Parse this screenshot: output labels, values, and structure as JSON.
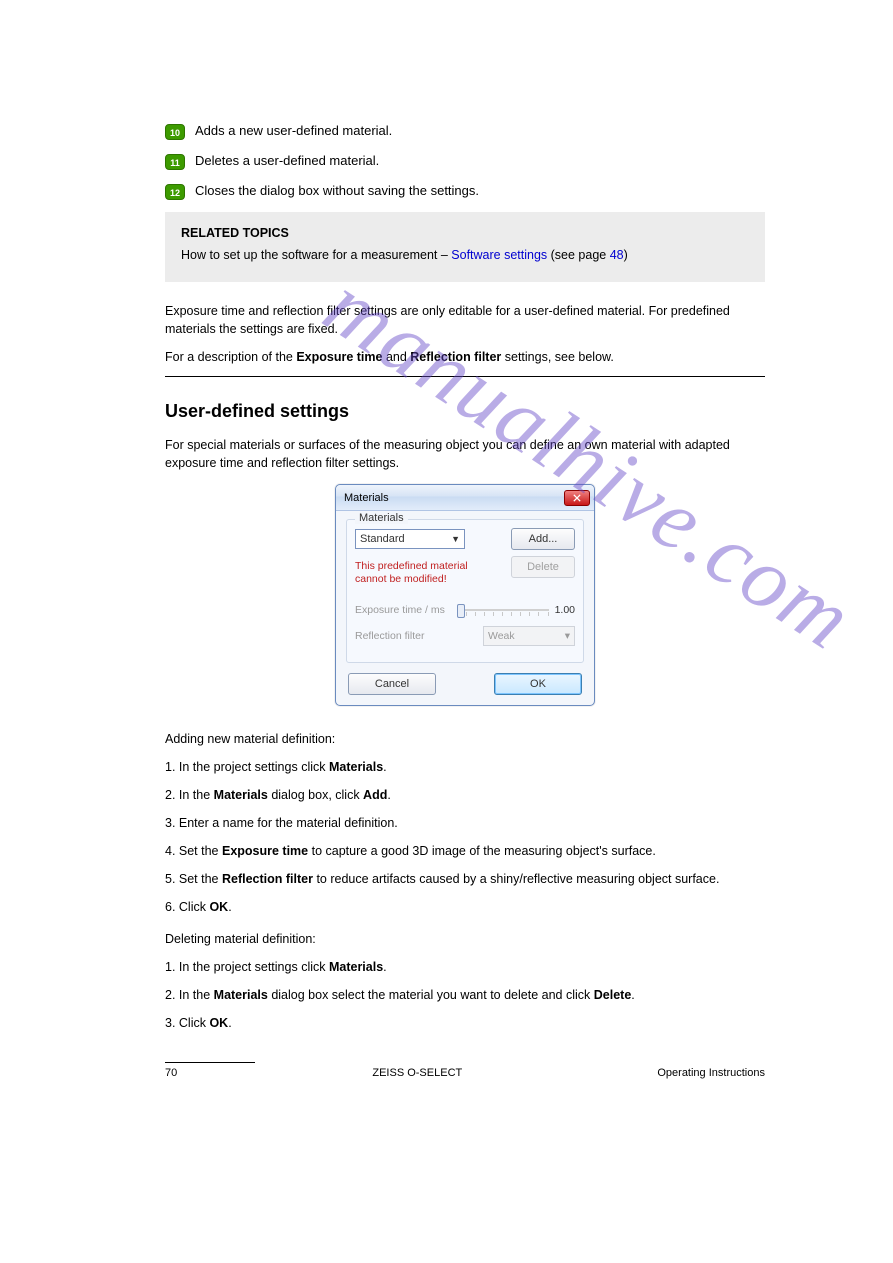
{
  "badges": {
    "b10": {
      "num": "10",
      "text": "Adds a new user-defined material."
    },
    "b11": {
      "num": "11",
      "text": "Deletes a user-defined material."
    },
    "b12": {
      "num": "12",
      "text": "Closes the dialog box without saving the settings."
    }
  },
  "callout": {
    "title": "RELATED TOPICS",
    "body1": "How to set up the software for a measurement – ",
    "body_link": "Software settings",
    "body2": " (see page ",
    "body_page": "48",
    "body3": ")"
  },
  "paragraphs": {
    "p1": "Exposure time and reflection filter settings are only editable for a user-defined material. For predefined materials the settings are fixed.",
    "p2a": "For a description of the ",
    "p2b": "Exposure time",
    "p2c": " and ",
    "p2d": "Reflection filter",
    "p2e": " settings, see below."
  },
  "section": {
    "title": "User-defined settings",
    "intro": "For special materials or surfaces of the measuring object you can define an own material with adapted exposure time and reflection filter settings."
  },
  "dialog": {
    "title": "Materials",
    "frame_label": "Materials",
    "selected": "Standard",
    "add": "Add...",
    "delete": "Delete",
    "warning_l1": "This predefined material",
    "warning_l2": "cannot be modified!",
    "exposure_label": "Exposure time / ms",
    "exposure_val": "1.00",
    "filter_label": "Reflection filter",
    "filter_val": "Weak",
    "cancel": "Cancel",
    "ok": "OK"
  },
  "steps": {
    "s1": "Adding new material definition:",
    "s1_1a": "1.  In the project settings click ",
    "s1_1b": "Materials",
    "s1_1c": ".",
    "s1_2a": "2.  In the ",
    "s1_2b": "Materials",
    "s1_2c": " dialog box, click ",
    "s1_2d": "Add",
    "s1_2e": ".",
    "s1_3": "3.  Enter a name for the material definition.",
    "s1_4a": "4.  Set the ",
    "s1_4b": "Exposure time",
    "s1_4c": " to capture a good 3D image of the measuring object's surface.",
    "s1_5a": "5.  Set the ",
    "s1_5b": "Reflection filter",
    "s1_5c": " to reduce artifacts caused by a shiny/reflective measuring object surface.",
    "s1_6a": "6.  Click ",
    "s1_6b": "OK",
    "s1_6c": ".",
    "s2": "Deleting material definition:",
    "s2_1a": "1.  In the project settings click ",
    "s2_1b": "Materials",
    "s2_1c": ".",
    "s2_2a": "2.  In the ",
    "s2_2b": "Materials",
    "s2_2c": " dialog box select the material you want to delete and click ",
    "s2_2d": "Delete",
    "s2_2e": ".",
    "s2_3a": "3.  Click ",
    "s2_3b": "OK",
    "s2_3c": "."
  },
  "footer": {
    "left": "70",
    "center": "ZEISS O-SELECT",
    "right": "Operating Instructions"
  },
  "watermark": "manualhive.com",
  "page_number": "70"
}
